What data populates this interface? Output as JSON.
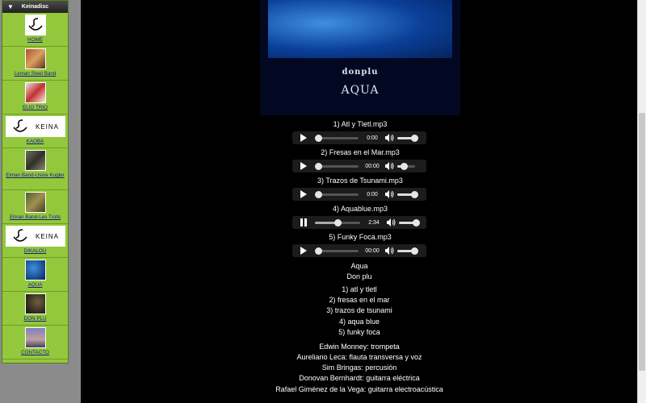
{
  "sidebar": {
    "header": "Keinadisc",
    "items": [
      {
        "label": "HOME",
        "icon": "keina-logo-icon"
      },
      {
        "label": "Leman Steel Band",
        "icon": "band-photo-icon"
      },
      {
        "label": "ELIO TRIO",
        "icon": "trio-photo-icon"
      },
      {
        "label": "KAOBA",
        "icon": "keina-wide-logo-icon",
        "logo_text": "KEINA"
      },
      {
        "label": "Elman Band-Usine Kugler",
        "icon": "band-photo-icon"
      },
      {
        "label": "Elman Band-Les Trolls",
        "icon": "band-photo-icon"
      },
      {
        "label": "DIKALOU",
        "icon": "keina-wide-logo-icon",
        "logo_text": "KEINA"
      },
      {
        "label": "AQUA",
        "icon": "aqua-cover-icon"
      },
      {
        "label": "DON PLU",
        "icon": "donplu-photo-icon"
      },
      {
        "label": "CONTACTO",
        "icon": "contact-photo-icon"
      }
    ]
  },
  "cover": {
    "artist": "donplu",
    "title": "AQUA"
  },
  "tracks": [
    {
      "title": "1) Atl y Tletl.mp3",
      "time": "0:00",
      "progress": 0.0,
      "volume": 1.0,
      "state": "paused"
    },
    {
      "title": "2) Fresas en el Mar.mp3",
      "time": "00:00",
      "progress": 0.0,
      "volume": 0.4,
      "state": "paused"
    },
    {
      "title": "3) Trazos de Tsunami.mp3",
      "time": "0:00",
      "progress": 0.0,
      "volume": 1.0,
      "state": "paused"
    },
    {
      "title": "4) Aquablue.mp3",
      "time": "2:34",
      "progress": 0.5,
      "volume": 1.0,
      "state": "playing"
    },
    {
      "title": "5) Funky Foca.mp3",
      "time": "00:00",
      "progress": 0.0,
      "volume": 1.0,
      "state": "paused"
    }
  ],
  "album": {
    "name": "Aqua",
    "artist": "Don plu",
    "tracklist": [
      "1) atl y tletl",
      "2) fresas en el mar",
      "3) trazos de tsunami",
      "4) aqua blue",
      "5) funky foca"
    ]
  },
  "credits": [
    "Edwin Monney: trompeta",
    "Aureliano Leca: flauta transversa y voz",
    "Sim Bringas: percusión",
    "Donovan Bernhardt: guitarra eléctrica",
    "Rafael Giménez de la Vega: guitarra electroacústica"
  ],
  "colors": {
    "sidebar_bg": "#93c83c",
    "link": "#1a1a8a",
    "page_bg": "#000000"
  }
}
